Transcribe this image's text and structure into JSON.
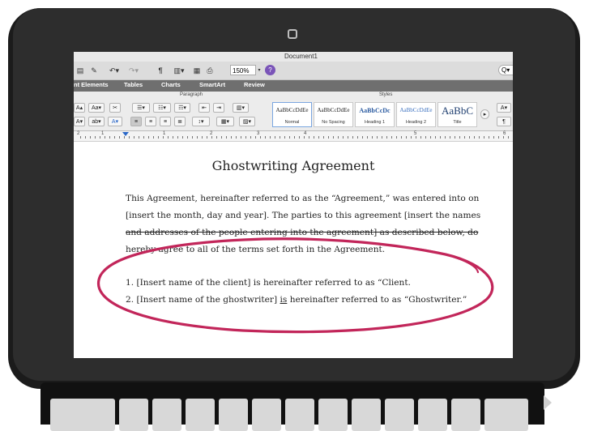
{
  "window": {
    "title": "Document1"
  },
  "toolbar": {
    "paragraph_mark": "¶",
    "zoom": "150%",
    "help_label": "?",
    "search_label": "Q▾"
  },
  "ribbon": {
    "tabs": [
      "nt Elements",
      "Tables",
      "Charts",
      "SmartArt",
      "Review"
    ],
    "paragraph_group_label": "Paragraph",
    "styles_group_label": "Styles",
    "styles": [
      {
        "sample": "AaBbCcDdEe",
        "name": "Normal"
      },
      {
        "sample": "AaBbCcDdEe",
        "name": "No Spacing"
      },
      {
        "sample": "AaBbCcDc",
        "name": "Heading 1"
      },
      {
        "sample": "AaBbCcDdEe",
        "name": "Heading 2"
      },
      {
        "sample": "AaBbC",
        "name": "Title"
      }
    ]
  },
  "ruler": {
    "numbers": [
      "2",
      "1",
      "1",
      "2",
      "3",
      "4",
      "5",
      "6"
    ]
  },
  "document": {
    "heading": "Ghostwriting Agreement",
    "paragraph_lines": [
      "This Agreement, hereinafter referred to as the “Agreement,” was entered into on",
      "[insert the month, day and year]. The parties to this agreement [insert the names",
      "and addresses of the people entering into the agreement] as described below, do",
      "hereby agree to all of the terms set forth in the Agreement."
    ],
    "list_item_1": "1. [Insert name of the client] is hereinafter referred to as “Client.",
    "list_item_2_before": "2. [Insert name of the ghostwriter] ",
    "list_item_2_is": "is",
    "list_item_2_after": " hereinafter referred to as “Ghostwriter.”"
  },
  "colors": {
    "bezel": "#2d2d2d",
    "ink_circle": "#c2265a",
    "ribbon_tabs": "#6f6f6f",
    "help_button": "#7a54b8"
  }
}
